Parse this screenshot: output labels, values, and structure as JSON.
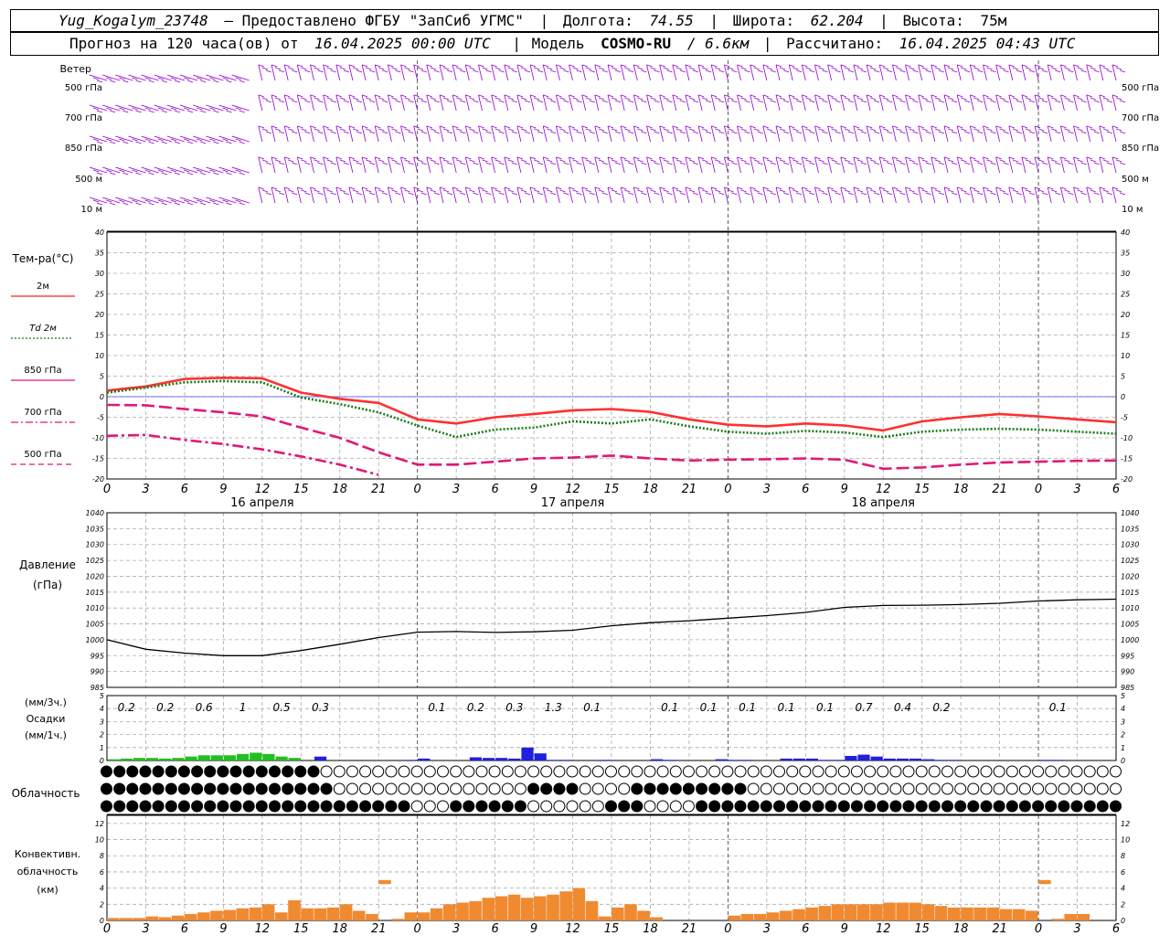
{
  "header": {
    "station": "Yug_Kogalym_23748",
    "provider": "— Предоставлено ФГБУ \"ЗапСиб УГМС\"",
    "lon_label": "Долгота:",
    "lon": "74.55",
    "lat_label": "Широта:",
    "lat": "62.204",
    "alt_label": "Высота:",
    "alt": "75м",
    "forecast_label": "Прогноз на 120 часа(ов) от",
    "forecast_start": "16.04.2025 00:00 UTC",
    "model_label": "Модель",
    "model": "COSMO-RU",
    "resolution": "/ 6.6км",
    "calc_label": "Рассчитано:",
    "calc_time": "16.04.2025 04:43 UTC",
    "sep": "|"
  },
  "wind": {
    "title": "Ветер",
    "levels": [
      "500 гПа",
      "700 гПа",
      "850 гПа",
      "500 м",
      "10 м"
    ],
    "color": "#9400d3"
  },
  "temp_panel": {
    "title": "Тем-ра(°С)",
    "legend": [
      {
        "label": "2м",
        "color": "#ff2020",
        "dash": "solid"
      },
      {
        "label": "Td 2м",
        "color": "#1a7a1a",
        "dash": "dot"
      },
      {
        "label": "850 гПа",
        "color": "#e0187a",
        "dash": "solid"
      },
      {
        "label": "700 гПа",
        "color": "#e0187a",
        "dash": "dashdot"
      },
      {
        "label": "500 гПа",
        "color": "#e0187a",
        "dash": "dash"
      }
    ]
  },
  "pressure_panel": {
    "title": "Давление",
    "unit": "(гПа)"
  },
  "precip_panel": {
    "unit_top": "(мм/3ч.)",
    "title": "Осадки",
    "unit_bottom": "(мм/1ч.)"
  },
  "cloud_panel": {
    "title": "Облачность"
  },
  "conv_panel": {
    "title_1": "Конвективн.",
    "title_2": "облачность",
    "unit": "(км)"
  },
  "x_tick_labels": [
    "0",
    "3",
    "6",
    "9",
    "12",
    "15",
    "18",
    "21",
    "0",
    "3",
    "6",
    "9",
    "12",
    "15",
    "18",
    "21",
    "0",
    "3",
    "6",
    "9",
    "12",
    "15",
    "18",
    "21",
    "0",
    "3",
    "6"
  ],
  "day_labels": [
    "16 апреля",
    "17 апреля",
    "18 апреля"
  ],
  "chart_data": [
    {
      "type": "line",
      "name": "temperature",
      "x_hours": [
        0,
        3,
        6,
        9,
        12,
        15,
        18,
        21,
        24,
        27,
        30,
        33,
        36,
        39,
        42,
        45,
        48,
        51,
        54,
        57,
        60,
        63,
        66,
        69,
        72,
        75,
        78
      ],
      "ylim": [
        -20,
        40
      ],
      "yticks": [
        -20,
        -15,
        -10,
        -5,
        0,
        5,
        10,
        15,
        20,
        25,
        30,
        35,
        40
      ],
      "series": [
        {
          "name": "2м",
          "values": [
            1.5,
            2.5,
            4.3,
            4.6,
            4.5,
            1.0,
            -0.5,
            -1.5,
            -5.5,
            -6.5,
            -5.0,
            -4.2,
            -3.3,
            -3.0,
            -3.7,
            -5.5,
            -6.8,
            -7.2,
            -6.5,
            -7.0,
            -8.2,
            -6.0,
            -5.0,
            -4.2,
            -4.8,
            -5.5,
            -6.2
          ]
        },
        {
          "name": "Td 2м",
          "values": [
            1.0,
            2.2,
            3.5,
            3.8,
            3.5,
            -0.2,
            -1.8,
            -3.8,
            -7.0,
            -9.8,
            -8.0,
            -7.5,
            -6.0,
            -6.5,
            -5.5,
            -7.2,
            -8.5,
            -9.0,
            -8.3,
            -8.7,
            -9.8,
            -8.5,
            -8.0,
            -7.8,
            -8.0,
            -8.5,
            -9.0
          ]
        },
        {
          "name": "850 гПа",
          "values": [
            -2.0,
            -2.1,
            -3.0,
            -3.8,
            -4.8,
            -7.5,
            -10.0,
            -13.5,
            -16.5,
            -16.5,
            -15.8,
            -15.0,
            -14.8,
            -14.3,
            -15.0,
            -15.5,
            -15.3,
            -15.2,
            -15.0,
            -15.3,
            -17.5,
            -17.2,
            -16.5,
            -16.0,
            -15.8,
            -15.6,
            -15.5
          ]
        },
        {
          "name": "700 гПа",
          "values": [
            -9.5,
            -9.3,
            -10.5,
            -11.5,
            -12.8,
            -14.5,
            -16.5,
            -19.0,
            null,
            null,
            null,
            null,
            null,
            null,
            null,
            null,
            null,
            null,
            null,
            null,
            null,
            null,
            null,
            null,
            null,
            null,
            null
          ]
        }
      ]
    },
    {
      "type": "line",
      "name": "pressure",
      "x_hours": [
        0,
        3,
        6,
        9,
        12,
        15,
        18,
        21,
        24,
        27,
        30,
        33,
        36,
        39,
        42,
        45,
        48,
        51,
        54,
        57,
        60,
        63,
        66,
        69,
        72,
        75,
        78
      ],
      "ylim": [
        985,
        1040
      ],
      "yticks": [
        985,
        990,
        995,
        1000,
        1005,
        1010,
        1015,
        1020,
        1025,
        1030,
        1035,
        1040
      ],
      "series": [
        {
          "name": "pressure",
          "values": [
            1000.0,
            997.0,
            995.8,
            995.0,
            995.0,
            996.6,
            998.6,
            1000.7,
            1002.4,
            1002.6,
            1002.3,
            1002.5,
            1003.0,
            1004.4,
            1005.4,
            1006.0,
            1006.8,
            1007.6,
            1008.6,
            1010.2,
            1010.8,
            1010.9,
            1011.1,
            1011.5,
            1012.2,
            1012.6,
            1012.8
          ]
        }
      ]
    },
    {
      "type": "bar",
      "name": "precipitation",
      "ylim": [
        0,
        5
      ],
      "yticks": [
        0,
        1,
        2,
        3,
        4,
        5
      ],
      "label_values": [
        "0.2",
        "0.2",
        "0.6",
        "1",
        "0.5",
        "0.3",
        "0.1",
        "0.2",
        "0.3",
        "1.3",
        "0.1",
        "0.1",
        "0.1",
        "0.1",
        "0.1",
        "0.1",
        "0.7",
        "0.4",
        "0.2",
        "0.1"
      ],
      "label_hours": [
        1.5,
        4.5,
        7.5,
        10.5,
        13.5,
        16.5,
        25.5,
        28.5,
        31.5,
        34.5,
        37.5,
        43.5,
        46.5,
        49.5,
        52.5,
        55.5,
        58.5,
        61.5,
        64.5,
        73.5
      ],
      "rain_color": "#2020e0",
      "snow_color": "#20c020",
      "hourly_hours": [
        1,
        2,
        3,
        4,
        5,
        6,
        7,
        8,
        9,
        10,
        11,
        12,
        13,
        14,
        15,
        17,
        24,
        25,
        29,
        30,
        31,
        32,
        33,
        34,
        35,
        36,
        39,
        43,
        44,
        48,
        49,
        50,
        53,
        54,
        55,
        56,
        57,
        58,
        59,
        60,
        61,
        62,
        63,
        64,
        65,
        66,
        73,
        74
      ],
      "hourly_values": [
        0.1,
        0.15,
        0.2,
        0.2,
        0.15,
        0.2,
        0.3,
        0.4,
        0.4,
        0.4,
        0.5,
        0.6,
        0.5,
        0.3,
        0.2,
        0.3,
        0.05,
        0.15,
        0.25,
        0.2,
        0.2,
        0.15,
        1.0,
        0.55,
        0.05,
        0.05,
        0.05,
        0.1,
        0.05,
        0.1,
        0.05,
        0.05,
        0.15,
        0.15,
        0.15,
        0.05,
        0.05,
        0.35,
        0.45,
        0.3,
        0.15,
        0.15,
        0.15,
        0.1,
        0.05,
        0.05,
        0.05,
        0.05
      ],
      "hourly_phase": [
        "snow",
        "snow",
        "snow",
        "snow",
        "snow",
        "snow",
        "snow",
        "snow",
        "snow",
        "snow",
        "snow",
        "snow",
        "snow",
        "snow",
        "snow",
        "rain",
        "rain",
        "rain",
        "rain",
        "rain",
        "rain",
        "rain",
        "rain",
        "rain",
        "rain",
        "rain",
        "rain",
        "rain",
        "rain",
        "rain",
        "rain",
        "rain",
        "rain",
        "rain",
        "rain",
        "rain",
        "rain",
        "rain",
        "rain",
        "rain",
        "rain",
        "rain",
        "rain",
        "rain",
        "rain",
        "rain",
        "rain",
        "rain"
      ]
    },
    {
      "type": "bar",
      "name": "convective_cloud",
      "ylim": [
        0,
        13
      ],
      "yticks": [
        0,
        2,
        4,
        6,
        8,
        10,
        12
      ],
      "color": "#f08a30",
      "hours": [
        0,
        1,
        2,
        3,
        4,
        5,
        6,
        7,
        8,
        9,
        10,
        11,
        12,
        13,
        14,
        15,
        16,
        17,
        18,
        19,
        20,
        21,
        22,
        23,
        24,
        25,
        26,
        27,
        28,
        29,
        30,
        31,
        32,
        33,
        34,
        35,
        36,
        37,
        38,
        39,
        40,
        41,
        42,
        43,
        44,
        45,
        46,
        47,
        48,
        49,
        50,
        51,
        52,
        53,
        54,
        55,
        56,
        57,
        58,
        59,
        60,
        61,
        62,
        63,
        64,
        65,
        66,
        67,
        68,
        69,
        70,
        71,
        72,
        73,
        74,
        75
      ],
      "bottoms": [
        0,
        0,
        0,
        0,
        0,
        0,
        0,
        0,
        0,
        0,
        0,
        0,
        0,
        0,
        0,
        0,
        0,
        0,
        0,
        0,
        0,
        4.5,
        0,
        0,
        0,
        0,
        0,
        0,
        0,
        0,
        0,
        0,
        0,
        0,
        0,
        0,
        0,
        0,
        0,
        0,
        0,
        0,
        0,
        0,
        0,
        0,
        0,
        0,
        0,
        0,
        0,
        0,
        0,
        0,
        0,
        0,
        0,
        0,
        0,
        0,
        0,
        0,
        0,
        0,
        0,
        0,
        0,
        0,
        0,
        0,
        0,
        0,
        4.5,
        0,
        0,
        0
      ],
      "tops": [
        0.3,
        0.3,
        0.3,
        0.5,
        0.4,
        0.6,
        0.8,
        1.0,
        1.2,
        1.3,
        1.5,
        1.6,
        2.0,
        1.0,
        2.5,
        1.5,
        1.5,
        1.6,
        2.0,
        1.2,
        0.8,
        5.0,
        0.2,
        1.0,
        1.0,
        1.5,
        2.0,
        2.2,
        2.4,
        2.8,
        3.0,
        3.2,
        2.8,
        3.0,
        3.2,
        3.6,
        4.0,
        2.4,
        0.5,
        1.6,
        2.0,
        1.2,
        0.4,
        0,
        0,
        0,
        0,
        0,
        0.6,
        0.8,
        0.8,
        1.0,
        1.2,
        1.4,
        1.6,
        1.8,
        2.0,
        2.0,
        2.0,
        2.0,
        2.2,
        2.2,
        2.2,
        2.0,
        1.8,
        1.6,
        1.6,
        1.6,
        1.6,
        1.4,
        1.4,
        1.2,
        5.0,
        0.2,
        0.8,
        0.8
      ]
    }
  ]
}
